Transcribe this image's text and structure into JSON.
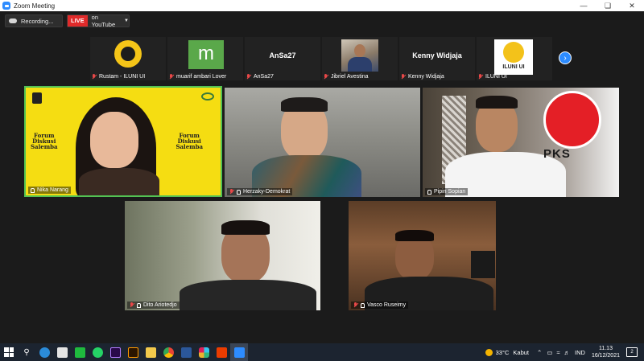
{
  "window": {
    "title": "Zoom Meeting"
  },
  "toolbar": {
    "recording_label": "Recording...",
    "live_label": "LIVE",
    "live_target": "on YouTube"
  },
  "strip": {
    "participants": [
      {
        "name": "Rustam - ILUNI UI",
        "display": "logo"
      },
      {
        "name": "muarif ambari Lover",
        "display": "m"
      },
      {
        "name": "AnSa27",
        "display": "AnSa27"
      },
      {
        "name": "Jibriel Avestina",
        "display": "camera"
      },
      {
        "name": "Kenny Widjaja",
        "display": "Kenny Widjaja"
      },
      {
        "name": "ILUNI UI",
        "display": "logo-iluni",
        "logo_text": "ILUNI UI"
      }
    ]
  },
  "gallery": {
    "tiles": [
      {
        "name": "Nika Narang",
        "banner": [
          "Forum",
          "Diskusi",
          "Salemba"
        ]
      },
      {
        "name": "Herzaky-Demokrat"
      },
      {
        "name": "Pipin Sopian",
        "badge": "PKS"
      },
      {
        "name": "Dito Ariotedjo"
      },
      {
        "name": "Vasco Ruseimy"
      }
    ]
  },
  "taskbar": {
    "weather": {
      "temp": "33°C",
      "condition": "Kabut"
    },
    "language": "IND",
    "time": "11.13",
    "date": "16/12/2021",
    "notifications": "2"
  },
  "colors": {
    "zoom_blue": "#2d8cff",
    "live_red": "#e02a2a",
    "active_speaker": "#53c253",
    "forum_yellow": "#f5dd12"
  }
}
